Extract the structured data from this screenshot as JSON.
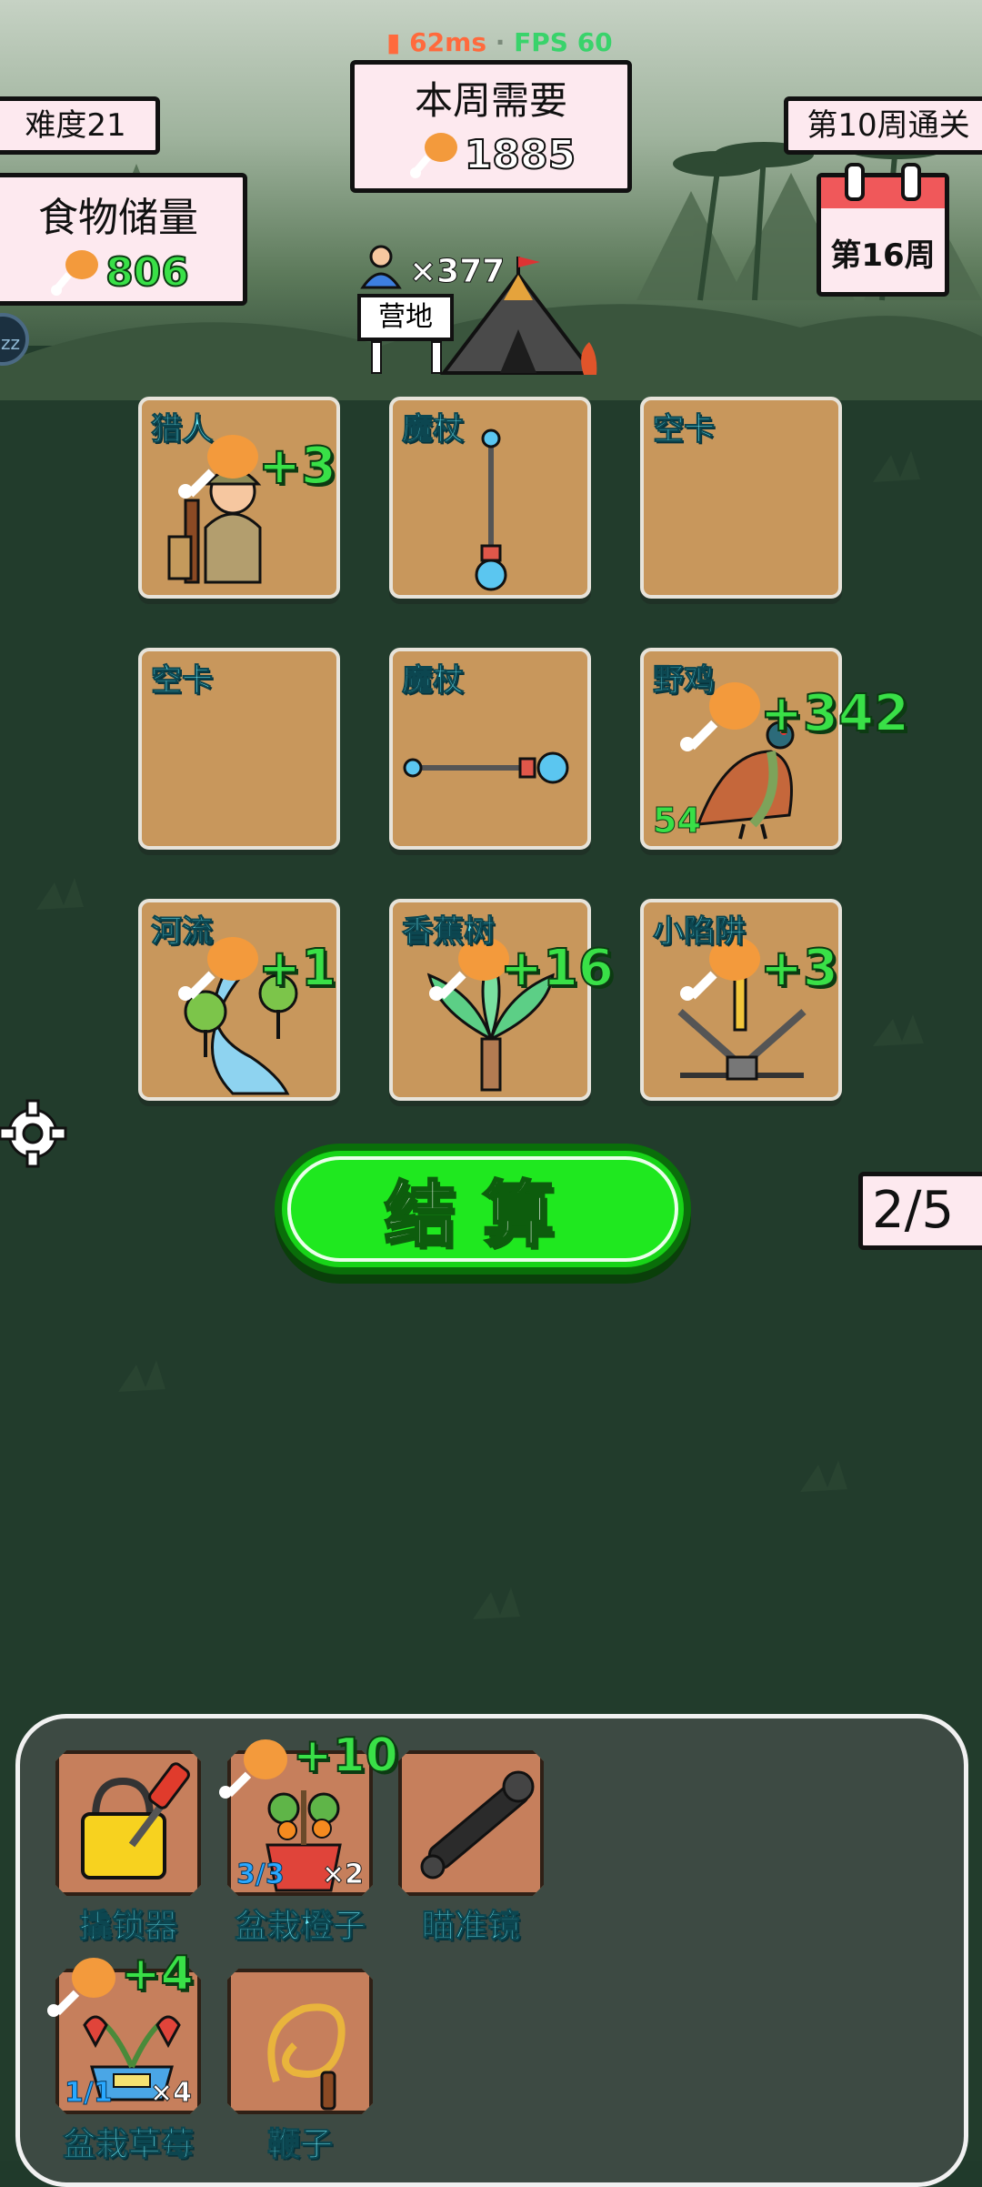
{
  "perf": {
    "ping": "62ms",
    "separator": " · ",
    "fps": "FPS 60"
  },
  "difficulty": "难度21",
  "week_need": {
    "title": "本周需要",
    "value": "1885"
  },
  "clear_goal": "第10周通关",
  "food": {
    "title": "食物储量",
    "value": "806"
  },
  "week_badge": "第16周",
  "camp": {
    "population": "×377",
    "sign": "营地"
  },
  "cards": [
    {
      "name": "猎人",
      "bonus": "+3",
      "icon": "hunter-icon"
    },
    {
      "name": "魔杖",
      "bonus": "",
      "icon": "wand-icon"
    },
    {
      "name": "空卡",
      "bonus": "",
      "icon": ""
    },
    {
      "name": "空卡",
      "bonus": "",
      "icon": ""
    },
    {
      "name": "魔杖",
      "bonus": "",
      "icon": "wand-icon"
    },
    {
      "name": "野鸡",
      "bonus": "+342",
      "count": "54",
      "icon": "pheasant-icon"
    },
    {
      "name": "河流",
      "bonus": "+1",
      "icon": "river-icon"
    },
    {
      "name": "香蕉树",
      "bonus": "+16",
      "icon": "banana-tree-icon"
    },
    {
      "name": "小陷阱",
      "bonus": "+3",
      "icon": "trap-icon"
    }
  ],
  "settle_label": "结算",
  "page_indicator": "2/5",
  "inventory": [
    {
      "name": "撬锁器",
      "icon": "lockpick-icon",
      "bonus": "",
      "uses": "",
      "mult": ""
    },
    {
      "name": "盆栽橙子",
      "icon": "potted-orange-icon",
      "bonus": "+10",
      "uses": "3/3",
      "mult": "×2"
    },
    {
      "name": "瞄准镜",
      "icon": "scope-icon",
      "bonus": "",
      "uses": "",
      "mult": ""
    },
    {
      "name": "盆栽草莓",
      "icon": "potted-strawberry-icon",
      "bonus": "+4",
      "uses": "1/1",
      "mult": "×4"
    },
    {
      "name": "鞭子",
      "icon": "whip-icon",
      "bonus": "",
      "uses": "",
      "mult": ""
    }
  ],
  "colors": {
    "card": "#c8975c",
    "accent_green": "#39e047",
    "label_cyan": "#6ff0ff",
    "panel": "#fde9ef"
  }
}
